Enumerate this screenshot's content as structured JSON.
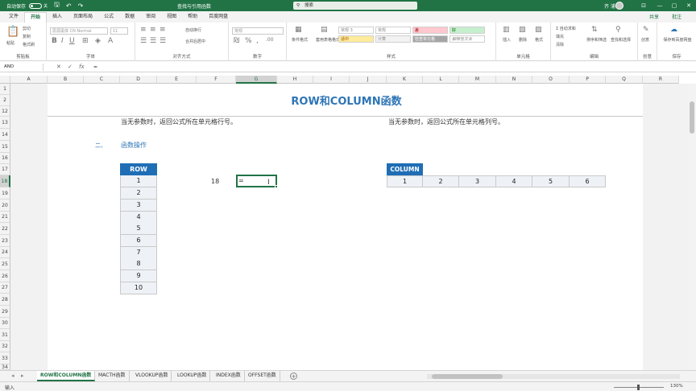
{
  "titlebar": {
    "autosave_label": "自动保存",
    "autosave_state": "关",
    "doc_title": "查找与引用函数",
    "search_placeholder": "搜索",
    "user_name": "齐 浦",
    "minimize": "—",
    "restore": "▢",
    "close": "✕"
  },
  "tabs": [
    "文件",
    "开始",
    "插入",
    "页面布局",
    "公式",
    "数据",
    "审阅",
    "视图",
    "帮助",
    "百度网盘"
  ],
  "tab_active": 1,
  "tabbar": {
    "share": "共享",
    "comment": "批注"
  },
  "ribbon": {
    "groups": [
      {
        "key": "clipboard",
        "label": "剪贴板"
      },
      {
        "key": "font",
        "label": "字体"
      },
      {
        "key": "align",
        "label": "对齐方式"
      },
      {
        "key": "number",
        "label": "数字"
      },
      {
        "key": "styles",
        "label": "样式"
      },
      {
        "key": "cells",
        "label": "单元格"
      },
      {
        "key": "edit",
        "label": "编辑"
      },
      {
        "key": "create",
        "label": "创意"
      },
      {
        "key": "save",
        "label": "保存"
      }
    ],
    "paste": "粘贴",
    "cut": "剪切",
    "copy": "复制",
    "format_painter": "格式刷",
    "font_name": "思源黑体 CN Normal",
    "font_size": "11",
    "wrap_text": "自动换行",
    "merge_center": "合并后居中",
    "number_format": "常规",
    "cond_format": "条件格式",
    "table_format": "套用表格格式",
    "style_normal": "常规 3",
    "style_normal2": "常规",
    "style_bad": "差",
    "style_good": "好",
    "style_neutral": "适中",
    "style_calc": "计算",
    "style_check": "检查单元格",
    "style_explain": "解释性文本",
    "insert": "插入",
    "delete": "删除",
    "format": "格式",
    "autosum": "自动求和",
    "fill": "填充",
    "clear": "清除",
    "sort_filter": "排序和筛选",
    "find_select": "查找和选择",
    "create_btn": "创意",
    "save_baidu": "保存到百度网盘"
  },
  "formula_bar": {
    "name_box": "AND",
    "cancel": "✕",
    "enter": "✓",
    "fx": "fx",
    "content": "="
  },
  "columns": [
    "A",
    "B",
    "C",
    "D",
    "E",
    "F",
    "G",
    "H",
    "I",
    "J",
    "K",
    "L",
    "M",
    "N",
    "O",
    "P",
    "Q",
    "R"
  ],
  "selected_column": "G",
  "rows": [
    "1",
    "2",
    "12",
    "13",
    "14",
    "15",
    "16",
    "17",
    "18",
    "19",
    "20",
    "21",
    "22",
    "23",
    "24",
    "25",
    "26",
    "27",
    "28",
    "29",
    "30",
    "31",
    "32",
    "33",
    "34"
  ],
  "selected_row": "18",
  "sheet": {
    "title": "ROW和COLUMN函数",
    "row_desc": "当无参数时，返回公式所在单元格行号。",
    "col_desc": "当无参数时，返回公式所在单元格列号。",
    "section_num": "二、",
    "section_title": "函数操作",
    "row_header": "ROW",
    "row_values": [
      "1",
      "2",
      "3",
      "4",
      "5",
      "6",
      "7",
      "8",
      "9",
      "10"
    ],
    "col_header": "COLUMN",
    "col_values": [
      "1",
      "2",
      "3",
      "4",
      "5",
      "6"
    ],
    "label_18": "18",
    "active_cell_text": "="
  },
  "sheet_tabs": [
    "ROW和COLUMN函数",
    "MACTH函数",
    "VLOOKUP函数",
    "LOOKUP函数",
    "INDEX函数",
    "OFFSET函数"
  ],
  "sheet_tab_active": 0,
  "status": {
    "mode": "输入",
    "zoom": "130%"
  },
  "colors": {
    "accent": "#217346",
    "table_header": "#1f6eb5",
    "title_blue": "#2e75b6"
  }
}
